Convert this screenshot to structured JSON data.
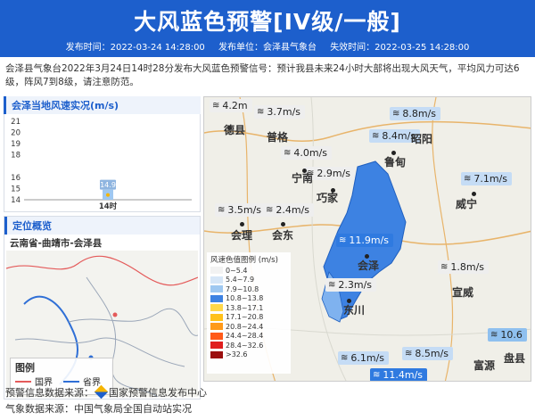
{
  "header": {
    "title": "大风蓝色预警[IV级/一般]",
    "publish_time": "发布时间：2022-03-24 14:28:00",
    "publisher": "发布单位：会泽县气象台",
    "expire_time": "失效时间：2022-03-25 14:28:00"
  },
  "description": "会泽县气象台2022年3月24日14时28分发布大风蓝色预警信号：预计我县未来24小时大部将出现大风天气，平均风力可达6级，阵风7到8级，请注意防范。",
  "wind_panel": {
    "title": "会泽当地风速实况(m/s)"
  },
  "chart_data": {
    "type": "bar",
    "title": "会泽当地风速实况(m/s)",
    "categories": [
      "14时"
    ],
    "values": [
      14.9
    ],
    "yticks": [
      14,
      15,
      16,
      18,
      19,
      20,
      21
    ],
    "ylim": [
      14,
      21
    ],
    "data_labels": [
      "14.9"
    ]
  },
  "location": {
    "title": "定位概览",
    "name": "云南省-曲靖市-会泽县"
  },
  "mini_legend": {
    "title": "图例",
    "items": [
      {
        "label": "国界",
        "color": "#e45a5a"
      },
      {
        "label": "省界",
        "color": "#2f6fd6"
      }
    ]
  },
  "map": {
    "labels": [
      {
        "text": "4.2m",
        "cls": "c0"
      },
      {
        "text": "3.7m/s",
        "cls": "c0"
      },
      {
        "text": "8.8m/s",
        "cls": "c1"
      },
      {
        "text": "8.4m/s",
        "cls": "c1"
      },
      {
        "text": "4.0m/s",
        "cls": "c0"
      },
      {
        "text": "2.9m/s",
        "cls": "c0"
      },
      {
        "text": "7.1m/s",
        "cls": "c1"
      },
      {
        "text": "3.5m/s",
        "cls": "c0"
      },
      {
        "text": "2.4m/s",
        "cls": "c0"
      },
      {
        "text": "11.9m/s",
        "cls": "c3"
      },
      {
        "text": "1.8m/s",
        "cls": "c0"
      },
      {
        "text": "2.3m/s",
        "cls": "c0"
      },
      {
        "text": "10.6",
        "cls": "c2"
      },
      {
        "text": "6.1m/s",
        "cls": "c1"
      },
      {
        "text": "8.5m/s",
        "cls": "c1"
      },
      {
        "text": "11.4m/s",
        "cls": "c3"
      }
    ],
    "cities": [
      "德县",
      "普格",
      "昭阳",
      "鲁甸",
      "宁南",
      "巧家",
      "威宁",
      "会理",
      "会东",
      "会泽",
      "宣威",
      "东川",
      "盘县",
      "富源"
    ]
  },
  "legend": {
    "title": "风速色值图例 (m/s)",
    "items": [
      {
        "label": "0~5.4",
        "color": "#f2f2f2"
      },
      {
        "label": "5.4~7.9",
        "color": "#d6e6f7"
      },
      {
        "label": "7.9~10.8",
        "color": "#9fc8f1"
      },
      {
        "label": "10.8~13.8",
        "color": "#3d82e2"
      },
      {
        "label": "13.8~17.1",
        "color": "#ffd84a"
      },
      {
        "label": "17.1~20.8",
        "color": "#ffc11a"
      },
      {
        "label": "20.8~24.4",
        "color": "#ff9a1a"
      },
      {
        "label": "24.4~28.4",
        "color": "#ff5a1a"
      },
      {
        "label": "28.4~32.6",
        "color": "#e01e1e"
      },
      {
        "label": ">32.6",
        "color": "#9b0f0f"
      }
    ]
  },
  "footer": {
    "warn_source_label": "预警信息数据来源：",
    "warn_source": "国家预警信息发布中心",
    "met_source_label": "气象数据来源：",
    "met_source": "中国气象局全国自动站实况"
  }
}
